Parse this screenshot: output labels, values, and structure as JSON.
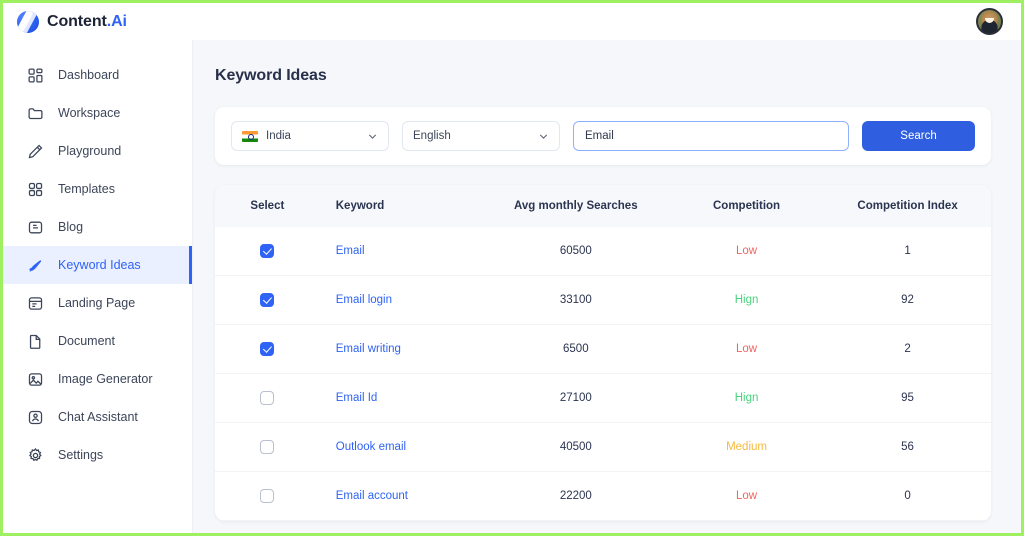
{
  "brand": {
    "name": "Content",
    "suffix": ".Ai",
    "logo_icon": "content-ai-logo-icon"
  },
  "topbar": {
    "avatar_icon": "user-avatar"
  },
  "sidebar": {
    "items": [
      {
        "label": "Dashboard",
        "icon": "dashboard-icon",
        "active": false
      },
      {
        "label": "Workspace",
        "icon": "folder-icon",
        "active": false
      },
      {
        "label": "Playground",
        "icon": "pencil-icon",
        "active": false
      },
      {
        "label": "Templates",
        "icon": "grid-icon",
        "active": false
      },
      {
        "label": "Blog",
        "icon": "blog-icon",
        "active": false
      },
      {
        "label": "Keyword Ideas",
        "icon": "keyword-ideas-icon",
        "active": true
      },
      {
        "label": "Landing Page",
        "icon": "landing-page-icon",
        "active": false
      },
      {
        "label": "Document",
        "icon": "document-icon",
        "active": false
      },
      {
        "label": "Image Generator",
        "icon": "image-icon",
        "active": false
      },
      {
        "label": "Chat Assistant",
        "icon": "chat-assistant-icon",
        "active": false
      },
      {
        "label": "Settings",
        "icon": "gear-icon",
        "active": false
      }
    ]
  },
  "main": {
    "page_title": "Keyword Ideas",
    "filters": {
      "country": {
        "value": "India",
        "flag_icon": "india-flag-icon",
        "chevron_icon": "chevron-down-icon"
      },
      "language": {
        "value": "English",
        "chevron_icon": "chevron-down-icon"
      },
      "search": {
        "value": "Email",
        "placeholder": "Enter keyword"
      },
      "search_button": "Search"
    },
    "table": {
      "headers": [
        "Select",
        "Keyword",
        "Avg monthly Searches",
        "Competition",
        "Competition Index"
      ],
      "rows": [
        {
          "selected": true,
          "keyword": "Email",
          "volume": "60500",
          "competition": "Low",
          "index": "1"
        },
        {
          "selected": true,
          "keyword": "Email login",
          "volume": "33100",
          "competition": "Hign",
          "index": "92"
        },
        {
          "selected": true,
          "keyword": "Email writing",
          "volume": "6500",
          "competition": "Low",
          "index": "2"
        },
        {
          "selected": false,
          "keyword": "Email Id",
          "volume": "27100",
          "competition": "Hign",
          "index": "95"
        },
        {
          "selected": false,
          "keyword": "Outlook email",
          "volume": "40500",
          "competition": "Medium",
          "index": "56"
        },
        {
          "selected": false,
          "keyword": "Email account",
          "volume": "22200",
          "competition": "Low",
          "index": "0"
        }
      ]
    }
  },
  "colors": {
    "accent": "#2f63f5",
    "button": "#2f5fe0",
    "low": "#f2635f",
    "high": "#4ad17f",
    "medium": "#f7b93e",
    "frame": "#9ef060"
  }
}
